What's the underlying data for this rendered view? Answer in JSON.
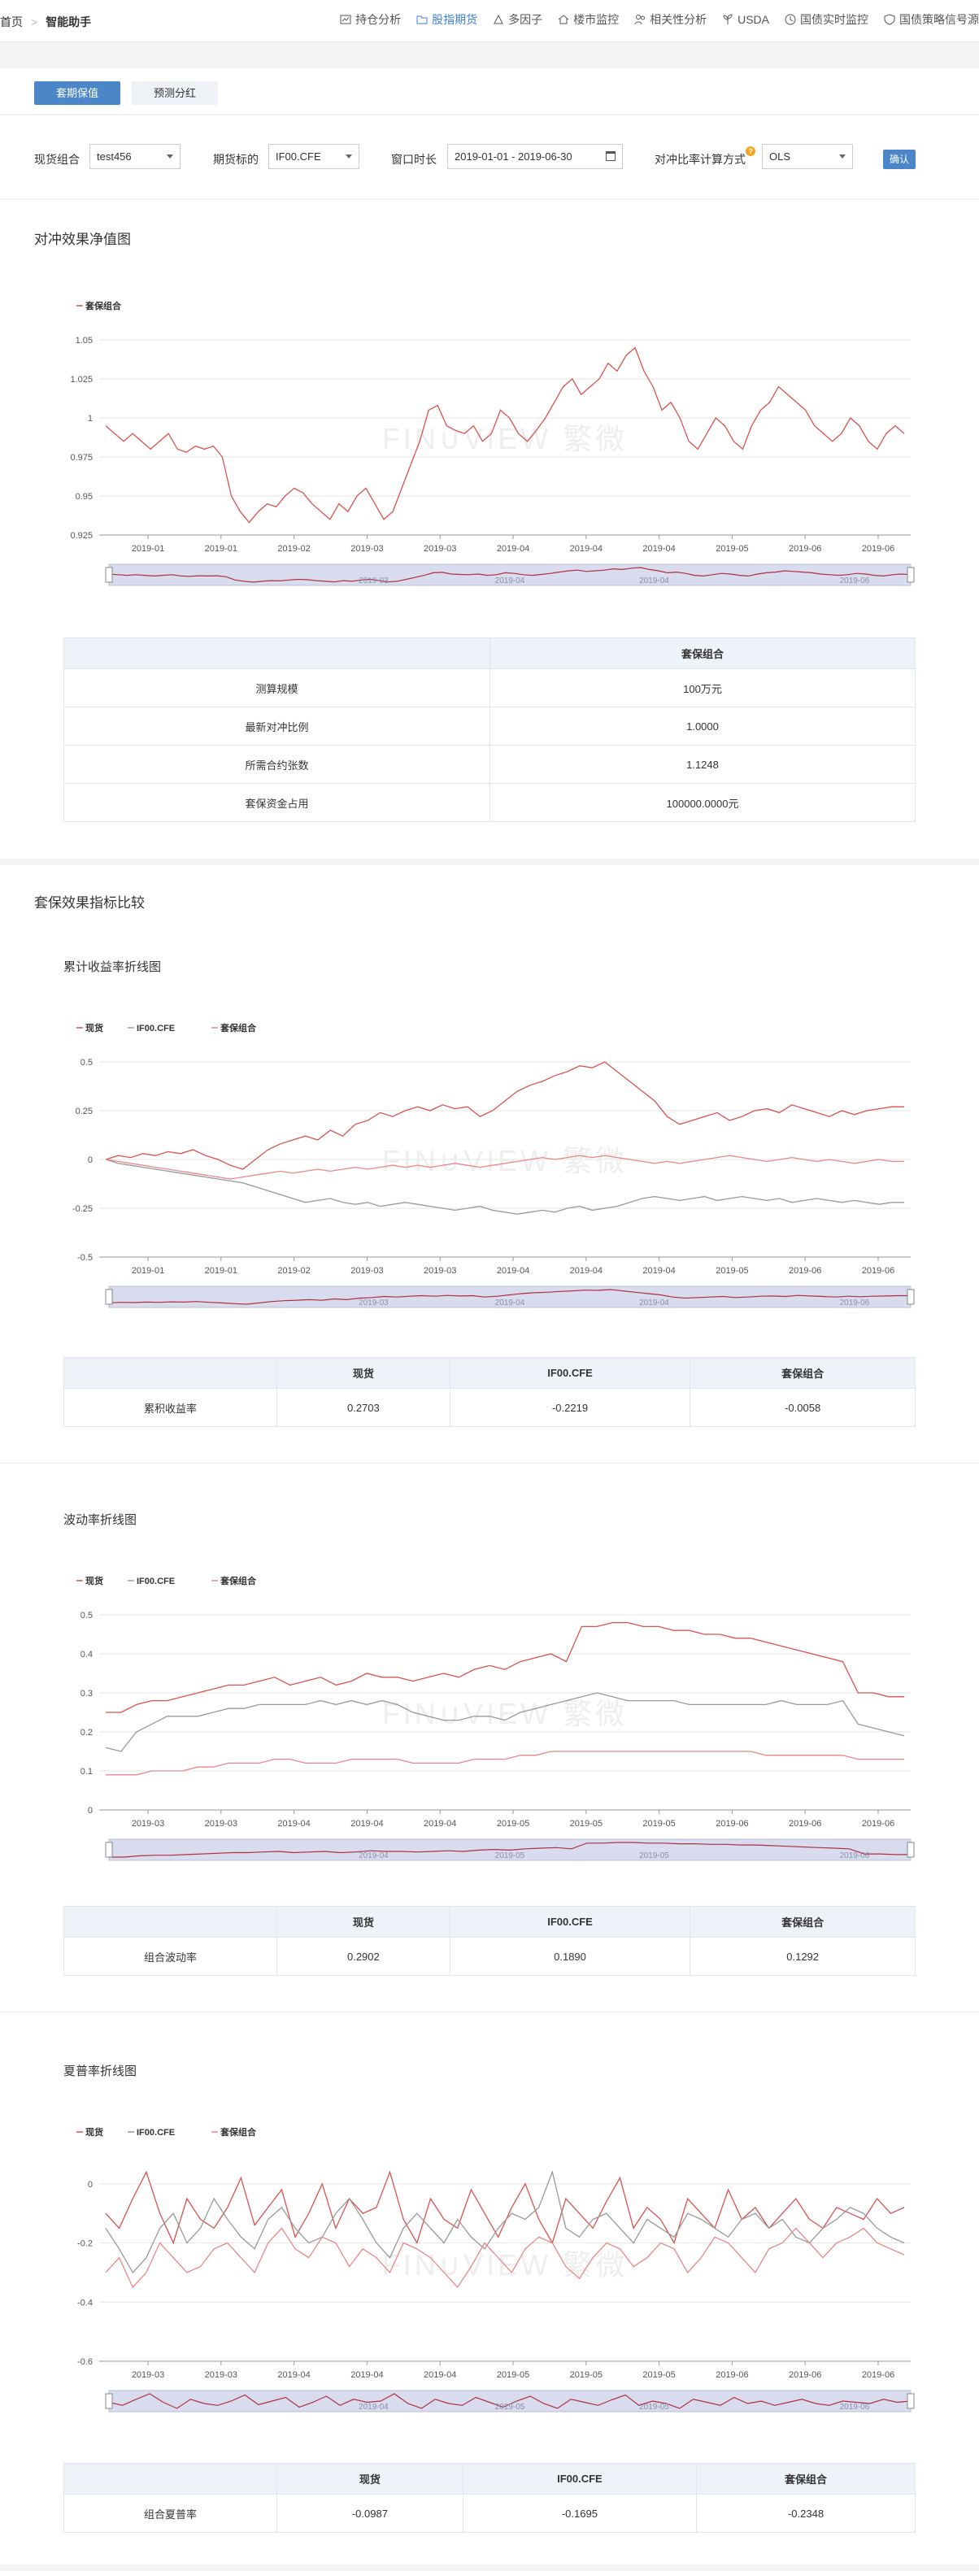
{
  "nav": {
    "breadcrumb_home": "首页",
    "breadcrumb_current": "智能助手",
    "items": [
      {
        "label": "持仓分析",
        "icon": "chart-icon",
        "active": false
      },
      {
        "label": "股指期货",
        "icon": "folder-icon",
        "active": true
      },
      {
        "label": "多因子",
        "icon": "factor-icon",
        "active": false
      },
      {
        "label": "楼市监控",
        "icon": "house-icon",
        "active": false
      },
      {
        "label": "相关性分析",
        "icon": "people-icon",
        "active": false
      },
      {
        "label": "USDA",
        "icon": "plant-icon",
        "active": false
      },
      {
        "label": "国债实时监控",
        "icon": "clock-icon",
        "active": false
      },
      {
        "label": "国债策略信号源",
        "icon": "shield-icon",
        "active": false
      }
    ]
  },
  "tabs": {
    "hedge": "套期保值",
    "dividend": "预测分红"
  },
  "filters": {
    "portfolio_label": "现货组合",
    "portfolio_value": "test456",
    "futures_label": "期货标的",
    "futures_value": "IF00.CFE",
    "window_label": "窗口时长",
    "window_value": "2019-01-01 - 2019-06-30",
    "method_label": "对冲比率计算方式",
    "method_value": "OLS",
    "confirm": "确认"
  },
  "section1": {
    "title": "对冲效果净值图",
    "table_header": "套保组合",
    "rows": [
      {
        "label": "测算规模",
        "value": "100万元"
      },
      {
        "label": "最新对冲比例",
        "value": "1.0000"
      },
      {
        "label": "所需合约张数",
        "value": "1.1248"
      },
      {
        "label": "套保资金占用",
        "value": "100000.0000元"
      }
    ]
  },
  "section2": {
    "title": "套保效果指标比较",
    "cols": [
      "现货",
      "IF00.CFE",
      "套保组合"
    ],
    "cum": {
      "title": "累计收益率折线图",
      "row_label": "累积收益率",
      "values": [
        "0.2703",
        "-0.2219",
        "-0.0058"
      ]
    },
    "vol": {
      "title": "波动率折线图",
      "row_label": "组合波动率",
      "values": [
        "0.2902",
        "0.1890",
        "0.1292"
      ]
    },
    "sharpe": {
      "title": "夏普率折线图",
      "row_label": "组合夏普率",
      "values": [
        "-0.0987",
        "-0.1695",
        "-0.2348"
      ]
    }
  },
  "watermark": "FIN∪VIEW 繁微",
  "colors": {
    "spot": "#d9534f",
    "futures": "#999999",
    "hedge": "#e8888a",
    "accent": "#4a86c8"
  },
  "chart_data": [
    {
      "type": "line",
      "title": "",
      "legend": [
        "套保组合"
      ],
      "x_ticks": [
        "2019-01",
        "2019-01",
        "2019-02",
        "2019-03",
        "2019-03",
        "2019-04",
        "2019-04",
        "2019-04",
        "2019-05",
        "2019-06",
        "2019-06"
      ],
      "y_ticks": [
        "1.05",
        "1.025",
        "1",
        "0.975",
        "0.95",
        "0.925"
      ],
      "ylim": [
        0.925,
        1.05
      ],
      "series": [
        {
          "name": "套保组合",
          "values": [
            0.995,
            0.99,
            0.985,
            0.99,
            0.985,
            0.98,
            0.985,
            0.99,
            0.98,
            0.978,
            0.982,
            0.98,
            0.982,
            0.975,
            0.95,
            0.94,
            0.933,
            0.94,
            0.945,
            0.943,
            0.95,
            0.955,
            0.952,
            0.945,
            0.94,
            0.935,
            0.945,
            0.94,
            0.95,
            0.955,
            0.945,
            0.935,
            0.94,
            0.955,
            0.97,
            0.985,
            1.005,
            1.008,
            0.995,
            0.992,
            0.99,
            0.995,
            0.985,
            0.99,
            1.005,
            1.0,
            0.99,
            0.985,
            0.992,
            1.0,
            1.01,
            1.02,
            1.025,
            1.015,
            1.02,
            1.025,
            1.035,
            1.03,
            1.04,
            1.045,
            1.03,
            1.02,
            1.005,
            1.01,
            1.0,
            0.985,
            0.98,
            0.99,
            1.0,
            0.995,
            0.985,
            0.98,
            0.995,
            1.005,
            1.01,
            1.02,
            1.015,
            1.01,
            1.005,
            0.995,
            0.99,
            0.985,
            0.99,
            1.0,
            0.995,
            0.985,
            0.98,
            0.99,
            0.995,
            0.99
          ]
        }
      ]
    },
    {
      "type": "line",
      "title": "",
      "legend": [
        "现货",
        "IF00.CFE",
        "套保组合"
      ],
      "x_ticks": [
        "2019-01",
        "2019-01",
        "2019-02",
        "2019-03",
        "2019-03",
        "2019-04",
        "2019-04",
        "2019-04",
        "2019-05",
        "2019-06",
        "2019-06"
      ],
      "y_ticks": [
        "0.5",
        "0.25",
        "0",
        "-0.25",
        "-0.5"
      ],
      "ylim": [
        -0.5,
        0.5
      ],
      "series": [
        {
          "name": "现货",
          "values": [
            0.0,
            0.02,
            0.01,
            0.03,
            0.02,
            0.04,
            0.03,
            0.05,
            0.02,
            0.0,
            -0.03,
            -0.05,
            0.0,
            0.05,
            0.08,
            0.1,
            0.12,
            0.1,
            0.15,
            0.12,
            0.18,
            0.2,
            0.24,
            0.22,
            0.25,
            0.27,
            0.25,
            0.28,
            0.26,
            0.27,
            0.22,
            0.25,
            0.3,
            0.35,
            0.38,
            0.4,
            0.43,
            0.45,
            0.48,
            0.47,
            0.5,
            0.45,
            0.4,
            0.35,
            0.3,
            0.22,
            0.18,
            0.2,
            0.22,
            0.24,
            0.2,
            0.22,
            0.25,
            0.26,
            0.24,
            0.28,
            0.26,
            0.24,
            0.22,
            0.25,
            0.23,
            0.25,
            0.26,
            0.27,
            0.27
          ]
        },
        {
          "name": "IF00.CFE",
          "values": [
            0.0,
            -0.02,
            -0.03,
            -0.04,
            -0.05,
            -0.06,
            -0.07,
            -0.08,
            -0.09,
            -0.1,
            -0.11,
            -0.12,
            -0.14,
            -0.16,
            -0.18,
            -0.2,
            -0.22,
            -0.21,
            -0.2,
            -0.22,
            -0.23,
            -0.22,
            -0.24,
            -0.23,
            -0.22,
            -0.23,
            -0.24,
            -0.25,
            -0.26,
            -0.25,
            -0.24,
            -0.26,
            -0.27,
            -0.28,
            -0.27,
            -0.26,
            -0.27,
            -0.25,
            -0.24,
            -0.26,
            -0.25,
            -0.24,
            -0.22,
            -0.2,
            -0.19,
            -0.2,
            -0.21,
            -0.2,
            -0.19,
            -0.21,
            -0.2,
            -0.19,
            -0.2,
            -0.21,
            -0.2,
            -0.22,
            -0.21,
            -0.2,
            -0.21,
            -0.22,
            -0.21,
            -0.22,
            -0.23,
            -0.22,
            -0.22
          ]
        },
        {
          "name": "套保组合",
          "values": [
            0.0,
            -0.01,
            -0.02,
            -0.03,
            -0.04,
            -0.05,
            -0.06,
            -0.07,
            -0.08,
            -0.09,
            -0.1,
            -0.09,
            -0.08,
            -0.07,
            -0.06,
            -0.07,
            -0.06,
            -0.05,
            -0.06,
            -0.05,
            -0.04,
            -0.05,
            -0.04,
            -0.03,
            -0.04,
            -0.03,
            -0.04,
            -0.03,
            -0.02,
            -0.03,
            -0.04,
            -0.03,
            -0.02,
            -0.01,
            0.0,
            0.01,
            0.0,
            0.01,
            0.02,
            0.01,
            0.02,
            0.01,
            0.0,
            -0.01,
            -0.02,
            -0.01,
            -0.02,
            -0.01,
            0.0,
            0.01,
            0.02,
            0.01,
            0.0,
            -0.01,
            0.0,
            0.01,
            0.0,
            -0.01,
            0.0,
            -0.01,
            -0.02,
            -0.01,
            0.0,
            -0.01,
            -0.01
          ]
        }
      ]
    },
    {
      "type": "line",
      "title": "",
      "legend": [
        "现货",
        "IF00.CFE",
        "套保组合"
      ],
      "x_ticks": [
        "2019-03",
        "2019-03",
        "2019-04",
        "2019-04",
        "2019-04",
        "2019-05",
        "2019-05",
        "2019-05",
        "2019-06",
        "2019-06",
        "2019-06"
      ],
      "y_ticks": [
        "0.5",
        "0.4",
        "0.3",
        "0.2",
        "0.1",
        "0"
      ],
      "ylim": [
        0,
        0.5
      ],
      "series": [
        {
          "name": "现货",
          "values": [
            0.25,
            0.25,
            0.27,
            0.28,
            0.28,
            0.29,
            0.3,
            0.31,
            0.32,
            0.32,
            0.33,
            0.34,
            0.32,
            0.33,
            0.34,
            0.32,
            0.33,
            0.35,
            0.34,
            0.34,
            0.33,
            0.34,
            0.35,
            0.34,
            0.36,
            0.37,
            0.36,
            0.38,
            0.39,
            0.4,
            0.38,
            0.47,
            0.47,
            0.48,
            0.48,
            0.47,
            0.47,
            0.46,
            0.46,
            0.45,
            0.45,
            0.44,
            0.44,
            0.43,
            0.42,
            0.41,
            0.4,
            0.39,
            0.38,
            0.3,
            0.3,
            0.29,
            0.29
          ]
        },
        {
          "name": "IF00.CFE",
          "values": [
            0.16,
            0.15,
            0.2,
            0.22,
            0.24,
            0.24,
            0.24,
            0.25,
            0.26,
            0.26,
            0.27,
            0.27,
            0.27,
            0.27,
            0.28,
            0.27,
            0.28,
            0.27,
            0.28,
            0.27,
            0.25,
            0.24,
            0.23,
            0.23,
            0.24,
            0.24,
            0.23,
            0.25,
            0.26,
            0.27,
            0.28,
            0.29,
            0.3,
            0.29,
            0.28,
            0.28,
            0.28,
            0.28,
            0.27,
            0.27,
            0.27,
            0.27,
            0.27,
            0.27,
            0.28,
            0.27,
            0.27,
            0.27,
            0.28,
            0.22,
            0.21,
            0.2,
            0.19
          ]
        },
        {
          "name": "套保组合",
          "values": [
            0.09,
            0.09,
            0.09,
            0.1,
            0.1,
            0.1,
            0.11,
            0.11,
            0.12,
            0.12,
            0.12,
            0.13,
            0.13,
            0.12,
            0.12,
            0.12,
            0.13,
            0.13,
            0.13,
            0.13,
            0.12,
            0.12,
            0.12,
            0.12,
            0.13,
            0.13,
            0.13,
            0.14,
            0.14,
            0.15,
            0.15,
            0.15,
            0.15,
            0.15,
            0.15,
            0.15,
            0.15,
            0.15,
            0.15,
            0.15,
            0.15,
            0.15,
            0.15,
            0.14,
            0.14,
            0.14,
            0.14,
            0.14,
            0.14,
            0.13,
            0.13,
            0.13,
            0.13
          ]
        }
      ]
    },
    {
      "type": "line",
      "title": "",
      "legend": [
        "现货",
        "IF00.CFE",
        "套保组合"
      ],
      "x_ticks": [
        "2019-03",
        "2019-03",
        "2019-04",
        "2019-04",
        "2019-04",
        "2019-05",
        "2019-05",
        "2019-05",
        "2019-06",
        "2019-06",
        "2019-06"
      ],
      "y_ticks": [
        "0",
        "-0.2",
        "-0.4",
        "-0.6"
      ],
      "ylim": [
        -0.6,
        0.06
      ],
      "series": [
        {
          "name": "现货",
          "values": [
            -0.1,
            -0.15,
            -0.05,
            0.04,
            -0.1,
            -0.2,
            -0.05,
            -0.12,
            -0.15,
            -0.08,
            0.02,
            -0.14,
            -0.08,
            -0.02,
            -0.18,
            -0.1,
            0.0,
            -0.15,
            -0.05,
            -0.1,
            -0.08,
            0.04,
            -0.12,
            -0.2,
            -0.05,
            -0.12,
            -0.15,
            -0.02,
            -0.1,
            -0.18,
            -0.08,
            0.0,
            -0.12,
            -0.2,
            -0.05,
            -0.1,
            -0.15,
            -0.06,
            0.02,
            -0.15,
            -0.08,
            -0.12,
            -0.2,
            -0.05,
            -0.1,
            -0.15,
            -0.02,
            -0.12,
            -0.08,
            -0.15,
            -0.1,
            -0.05,
            -0.12,
            -0.15,
            -0.08,
            -0.1,
            -0.12,
            -0.05,
            -0.1,
            -0.08
          ]
        },
        {
          "name": "IF00.CFE",
          "values": [
            -0.15,
            -0.22,
            -0.3,
            -0.25,
            -0.15,
            -0.1,
            -0.2,
            -0.15,
            -0.05,
            -0.12,
            -0.18,
            -0.22,
            -0.12,
            -0.08,
            -0.15,
            -0.2,
            -0.18,
            -0.1,
            -0.05,
            -0.12,
            -0.2,
            -0.25,
            -0.15,
            -0.1,
            -0.15,
            -0.2,
            -0.12,
            -0.18,
            -0.22,
            -0.15,
            -0.1,
            -0.12,
            -0.08,
            0.04,
            -0.15,
            -0.18,
            -0.12,
            -0.1,
            -0.15,
            -0.2,
            -0.12,
            -0.15,
            -0.18,
            -0.1,
            -0.12,
            -0.15,
            -0.18,
            -0.12,
            -0.1,
            -0.15,
            -0.12,
            -0.18,
            -0.2,
            -0.15,
            -0.12,
            -0.08,
            -0.1,
            -0.15,
            -0.18,
            -0.2
          ]
        },
        {
          "name": "套保组合",
          "values": [
            -0.3,
            -0.25,
            -0.35,
            -0.3,
            -0.2,
            -0.25,
            -0.3,
            -0.28,
            -0.22,
            -0.2,
            -0.25,
            -0.3,
            -0.2,
            -0.15,
            -0.22,
            -0.25,
            -0.18,
            -0.2,
            -0.28,
            -0.22,
            -0.25,
            -0.3,
            -0.2,
            -0.22,
            -0.25,
            -0.3,
            -0.35,
            -0.28,
            -0.2,
            -0.25,
            -0.3,
            -0.22,
            -0.18,
            -0.2,
            -0.28,
            -0.32,
            -0.25,
            -0.2,
            -0.22,
            -0.28,
            -0.25,
            -0.2,
            -0.22,
            -0.3,
            -0.25,
            -0.18,
            -0.2,
            -0.25,
            -0.3,
            -0.22,
            -0.2,
            -0.15,
            -0.2,
            -0.25,
            -0.2,
            -0.18,
            -0.15,
            -0.2,
            -0.22,
            -0.24
          ]
        }
      ]
    }
  ]
}
